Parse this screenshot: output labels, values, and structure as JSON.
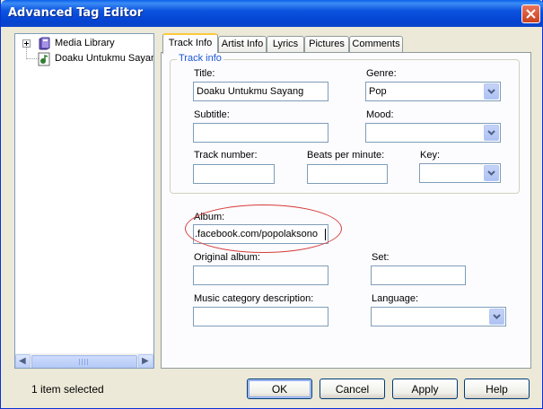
{
  "window": {
    "title": "Advanced Tag Editor",
    "close_icon": "close-icon"
  },
  "tree": {
    "items": [
      {
        "label": "Media Library",
        "icon": "library-icon",
        "expander": "+"
      },
      {
        "label": "Doaku Untukmu Sayang",
        "icon": "audio-file-icon"
      }
    ],
    "scrollbar": {
      "left_arrow": "◀",
      "right_arrow": "▶"
    }
  },
  "tabs": [
    {
      "label": "Track Info",
      "active": true
    },
    {
      "label": "Artist Info"
    },
    {
      "label": "Lyrics"
    },
    {
      "label": "Pictures"
    },
    {
      "label": "Comments"
    }
  ],
  "track_info": {
    "group_title": "Track info",
    "title": {
      "label": "Title:",
      "value": "Doaku Untukmu Sayang"
    },
    "genre": {
      "label": "Genre:",
      "value": "Pop"
    },
    "subtitle": {
      "label": "Subtitle:",
      "value": ""
    },
    "mood": {
      "label": "Mood:",
      "value": ""
    },
    "track_number": {
      "label": "Track number:",
      "value": ""
    },
    "bpm": {
      "label": "Beats per minute:",
      "value": ""
    },
    "key": {
      "label": "Key:",
      "value": ""
    }
  },
  "album_info": {
    "album": {
      "label": "Album:",
      "value": ".facebook.com/popolaksono"
    },
    "original_album": {
      "label": "Original album:",
      "value": ""
    },
    "set": {
      "label": "Set:",
      "value": ""
    },
    "music_category": {
      "label": "Music category description:",
      "value": ""
    },
    "language": {
      "label": "Language:",
      "value": ""
    }
  },
  "annotation": {
    "color": "#D83A3A",
    "shape": "ellipse around Album field"
  },
  "status": "1 item selected",
  "buttons": {
    "ok": "OK",
    "cancel": "Cancel",
    "apply": "Apply",
    "help": "Help"
  },
  "colors": {
    "titlebar": "#0A4FD6",
    "dialog_bg": "#ECE9D8",
    "group_title": "#1B55D6",
    "active_tab_accent": "#FFC83C"
  }
}
